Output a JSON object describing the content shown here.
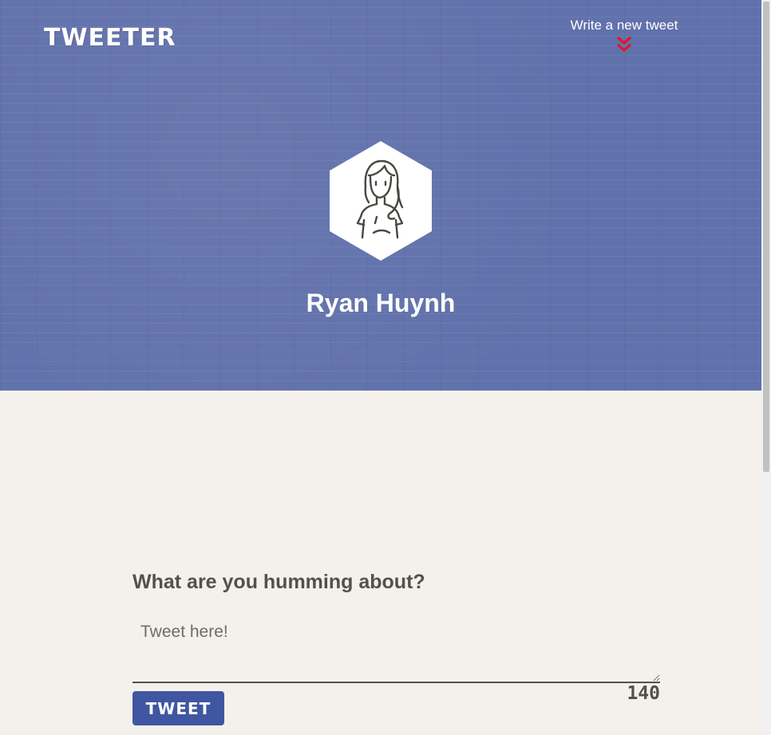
{
  "nav": {
    "logo": "TWEETER",
    "compose_toggle_label": "Write a new tweet",
    "compose_toggle_icon": "double-chevron-down-icon"
  },
  "profile": {
    "name": "Ryan Huynh",
    "avatar_icon": "person-avatar-icon"
  },
  "composer": {
    "heading": "What are you humming about?",
    "placeholder": "Tweet here!",
    "value": "",
    "button_label": "TWEET",
    "char_counter": "140"
  },
  "colors": {
    "banner": "#6171ab",
    "background": "#f4f1ec",
    "accent_button": "#4056a1",
    "arrow": "#e8121b",
    "text": "#545149"
  }
}
